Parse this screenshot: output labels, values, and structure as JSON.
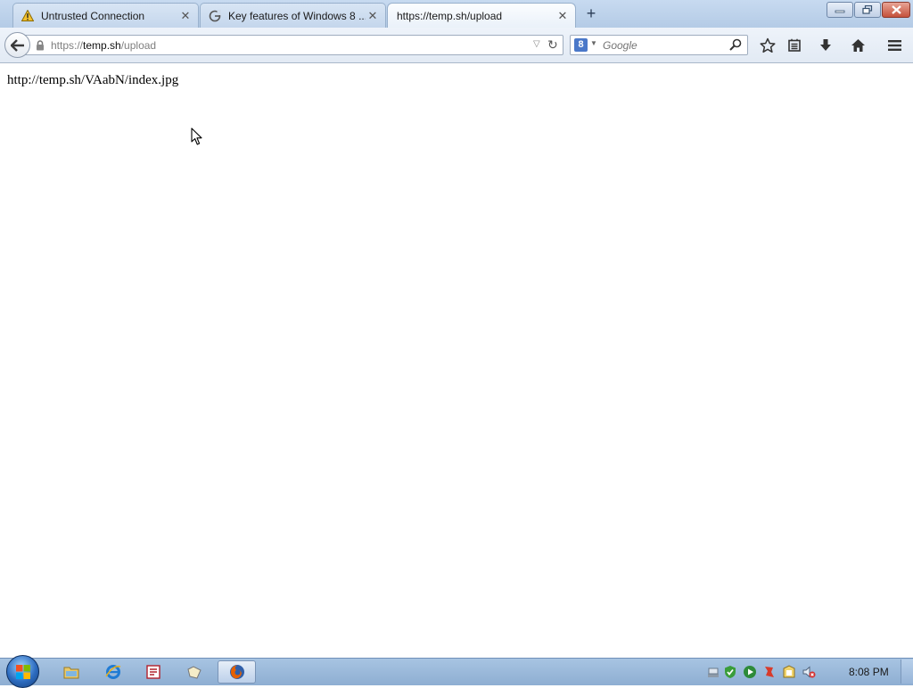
{
  "browser": {
    "tabs": [
      {
        "label": "Untrusted Connection",
        "icon": "warning-icon"
      },
      {
        "label": "Key features of Windows 8 ...",
        "icon": "google-g-icon"
      },
      {
        "label": "https://temp.sh/upload",
        "icon": ""
      }
    ],
    "url": {
      "prefix": "https://",
      "host": "temp.sh",
      "path": "/upload"
    },
    "search": {
      "placeholder": "Google",
      "engine_letter": "8"
    }
  },
  "page": {
    "text": "http://temp.sh/VAabN/index.jpg"
  },
  "taskbar": {
    "apps": [
      "windows-explorer-icon",
      "internet-explorer-icon",
      "app-icon",
      "app-icon",
      "firefox-icon"
    ],
    "clock": "8:08 PM"
  },
  "colors": {
    "accent": "#2d6cc0",
    "titlebar": "#b4cbe6",
    "taskbar": "#8eaed2",
    "close_button": "#c4513b"
  }
}
